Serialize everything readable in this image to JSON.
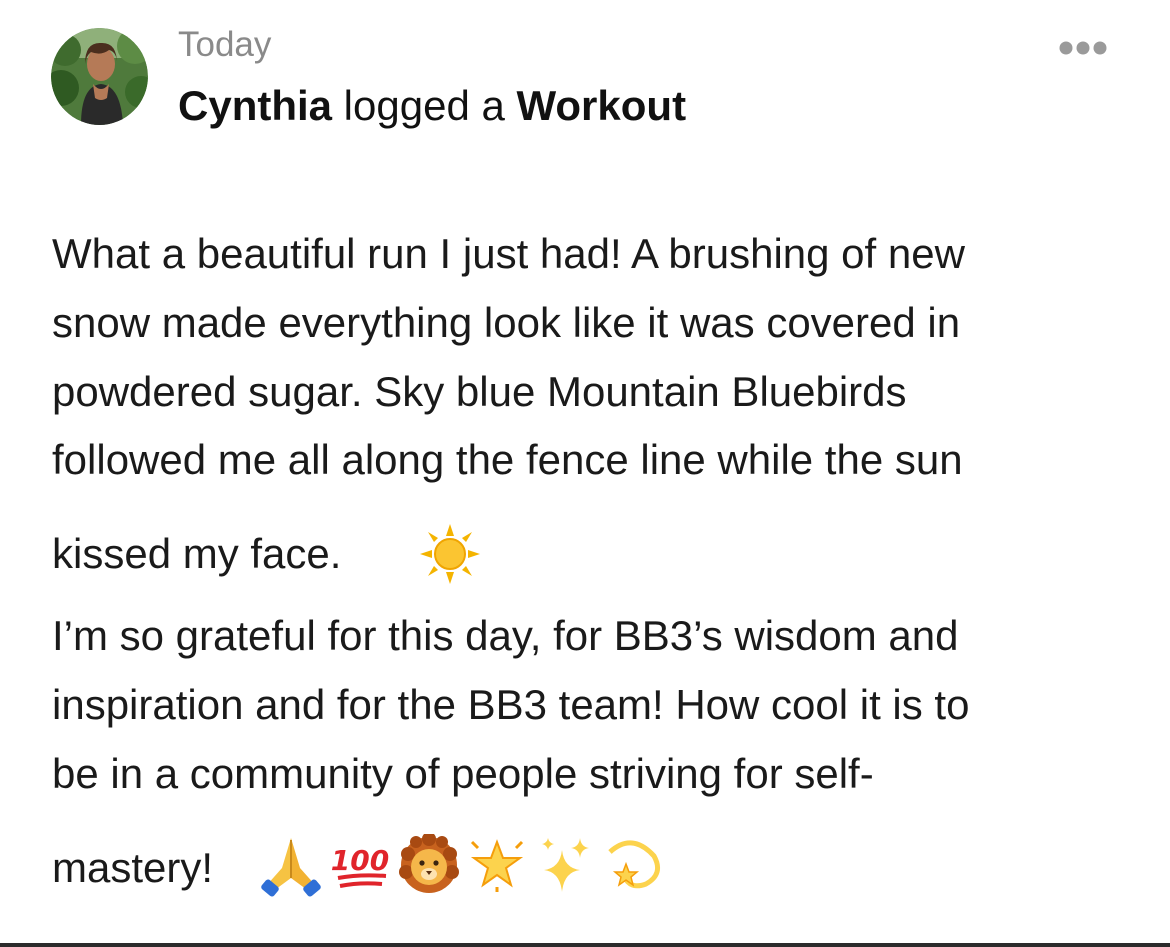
{
  "post": {
    "timestamp": "Today",
    "author": "Cynthia",
    "action": " logged a ",
    "activity": "Workout",
    "lines": [
      "What a beautiful run I just had!  A brushing of new",
      "snow made everything look like it was covered in",
      "powdered sugar.  Sky blue Mountain Bluebirds",
      "followed me all along the fence line while the sun",
      "kissed my face.",
      "I’m so grateful for this day, for BB3’s wisdom and",
      "inspiration and for the BB3 team!  How cool it is to",
      "be in a community of people striving for self-",
      "mastery!"
    ],
    "emoji_after_face": [
      "sun-emoji"
    ],
    "emoji_after_mastery": [
      "folded-hands-emoji",
      "hundred-points-emoji",
      "lion-emoji",
      "glowing-star-emoji",
      "sparkles-emoji",
      "dizzy-emoji"
    ],
    "hundred_text": "100"
  },
  "colors": {
    "timestamp": "#8a8a8a",
    "text": "#1a1a1a",
    "more_dots": "#9a9a9a",
    "divider": "#2b2b2b"
  }
}
